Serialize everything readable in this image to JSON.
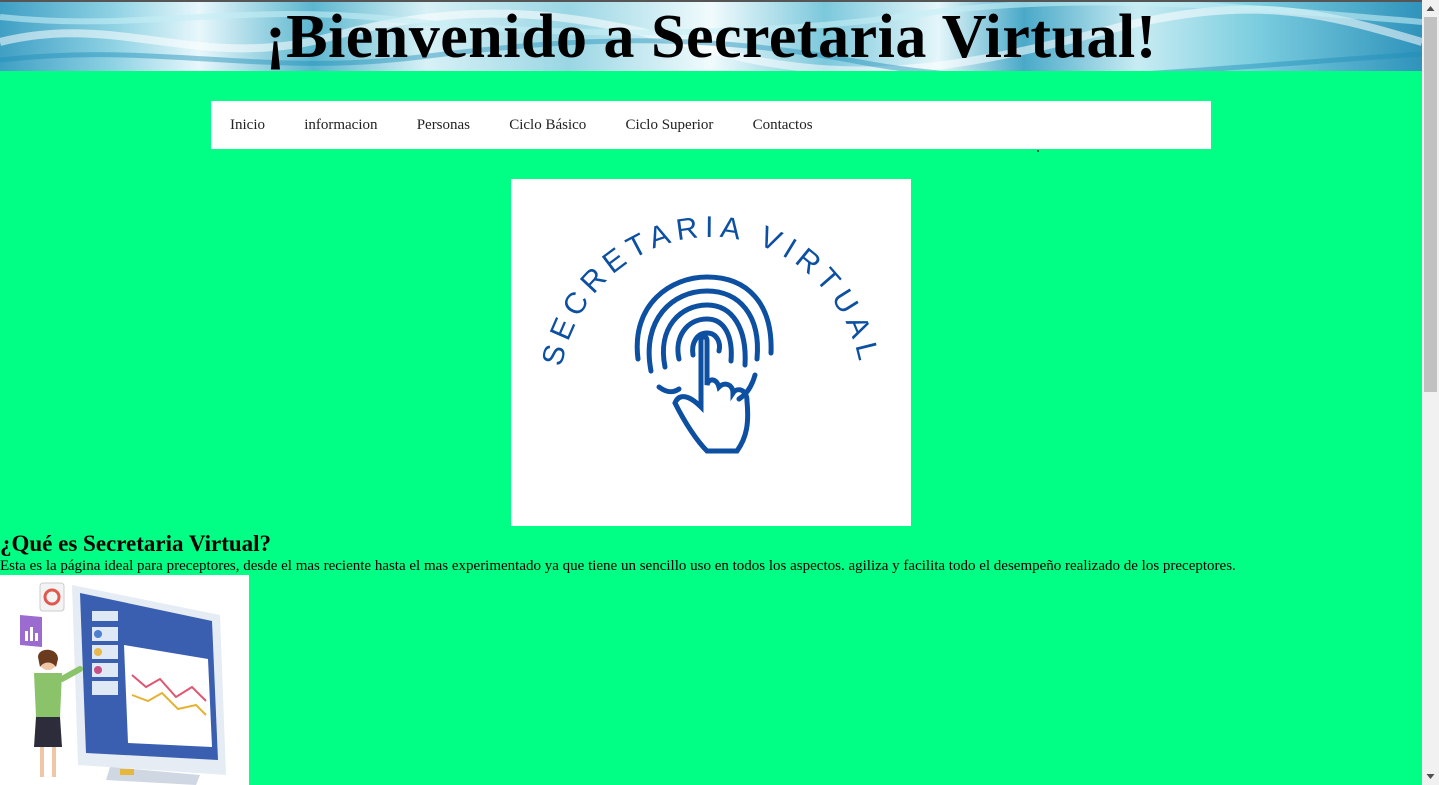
{
  "header": {
    "title": "¡Bienvenido a Secretaria Virtual!"
  },
  "nav": {
    "items": [
      {
        "label": "Inicio"
      },
      {
        "label": "informacion"
      },
      {
        "label": "Personas"
      },
      {
        "label": "Ciclo Básico"
      },
      {
        "label": "Ciclo Superior"
      },
      {
        "label": "Contactos"
      }
    ]
  },
  "logo": {
    "text": "SECRETARIA VIRTUAL",
    "icon": "fingerprint-hand-icon",
    "color": "#0d4fa0"
  },
  "main": {
    "section_title": "¿Qué es Secretaria Virtual?",
    "section_text": "Esta es la página ideal para preceptores, desde el mas reciente hasta el mas experimentado ya que tiene un sencillo uso en todos los aspectos. agiliza y facilita todo el desempeño realizado de los preceptores."
  },
  "colors": {
    "page_background": "#00ff84",
    "nav_background": "#ffffff",
    "logo_blue": "#0d4fa0"
  }
}
